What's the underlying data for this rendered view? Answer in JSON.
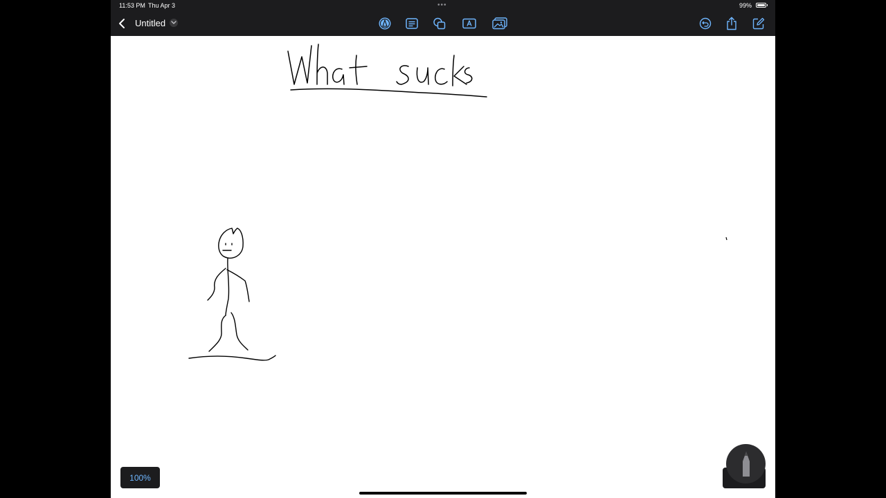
{
  "status_bar": {
    "time": "11:53 PM",
    "date": "Thu Apr 3",
    "battery": "99%"
  },
  "toolbar": {
    "title": "Untitled",
    "icons": [
      "back-icon",
      "chevron-down-icon",
      "pen-tool-icon",
      "text-block-icon",
      "shapes-icon",
      "text-box-icon",
      "image-icon",
      "undo-icon",
      "share-icon",
      "compose-icon"
    ]
  },
  "canvas": {
    "handwritten_title": "What sucks",
    "drawing": "stick-figure"
  },
  "zoom": {
    "level": "100%"
  },
  "colors": {
    "toolbar_bg": "#1c1c1e",
    "accent": "#6fb6ff",
    "ink": "#000000"
  }
}
